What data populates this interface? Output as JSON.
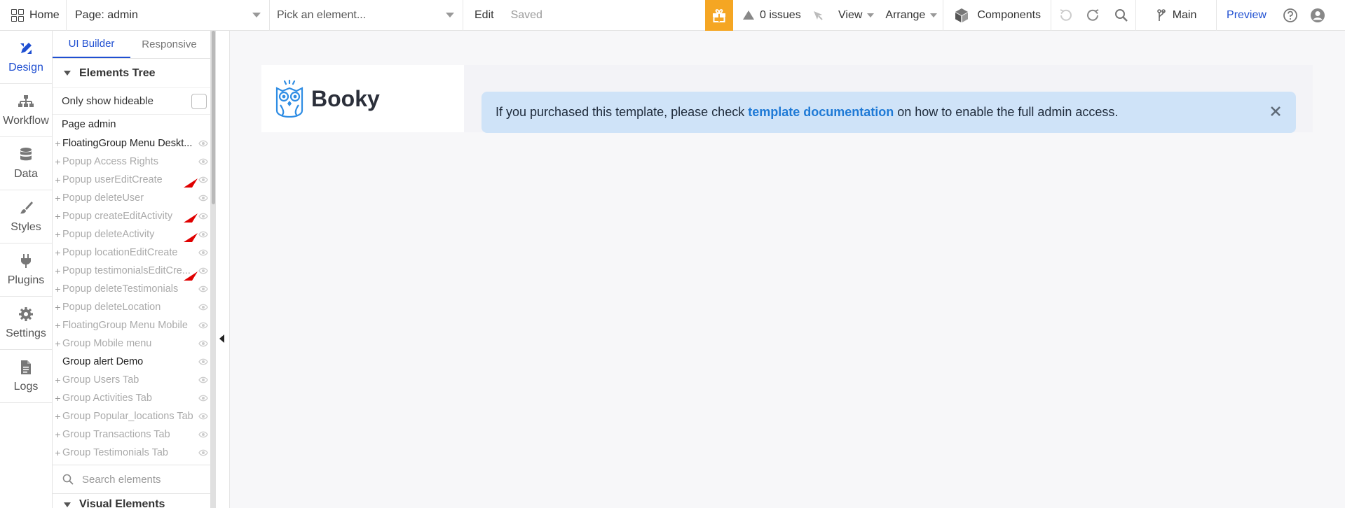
{
  "topbar": {
    "home_label": "Home",
    "page_label": "Page: admin",
    "pick_placeholder": "Pick an element...",
    "edit_label": "Edit",
    "saved_label": "Saved",
    "issues_label": "0 issues",
    "view_label": "View",
    "arrange_label": "Arrange",
    "components_label": "Components",
    "branch_label": "Main",
    "preview_label": "Preview"
  },
  "rail": {
    "items": [
      {
        "label": "Design"
      },
      {
        "label": "Workflow"
      },
      {
        "label": "Data"
      },
      {
        "label": "Styles"
      },
      {
        "label": "Plugins"
      },
      {
        "label": "Settings"
      },
      {
        "label": "Logs"
      }
    ]
  },
  "panel": {
    "tabs": [
      {
        "label": "UI Builder"
      },
      {
        "label": "Responsive"
      }
    ],
    "tree_title": "Elements Tree",
    "only_show_label": "Only show hideable",
    "page_item": "Page admin",
    "items": [
      {
        "label": "FloatingGroup Menu Deskt..."
      },
      {
        "label": "Popup Access Rights"
      },
      {
        "label": "Popup userEditCreate"
      },
      {
        "label": "Popup deleteUser"
      },
      {
        "label": "Popup createEditActivity"
      },
      {
        "label": "Popup deleteActivity"
      },
      {
        "label": "Popup locationEditCreate"
      },
      {
        "label": "Popup testimonialsEditCre..."
      },
      {
        "label": "Popup deleteTestimonials"
      },
      {
        "label": "Popup deleteLocation"
      },
      {
        "label": "FloatingGroup Menu Mobile"
      },
      {
        "label": "Group Mobile menu"
      },
      {
        "label": "Group alert Demo"
      },
      {
        "label": "Group Users Tab"
      },
      {
        "label": "Group Activities Tab"
      },
      {
        "label": "Group Popular_locations Tab"
      },
      {
        "label": "Group Transactions Tab"
      },
      {
        "label": "Group Testimonials Tab"
      }
    ],
    "search_placeholder": "Search elements",
    "visual_title": "Visual Elements"
  },
  "canvas": {
    "logo_text": "Booky",
    "alert_before": "If you purchased this template, please check",
    "alert_link": "template documentation",
    "alert_after": "on how to enable the full admin access."
  },
  "colors": {
    "accent": "#1f4fd1",
    "gift": "#f5a623",
    "alert_bg": "#cfe3f8",
    "alert_link": "#1f7ad6",
    "logo_blue": "#2f8de4",
    "annotation": "#e00000"
  }
}
